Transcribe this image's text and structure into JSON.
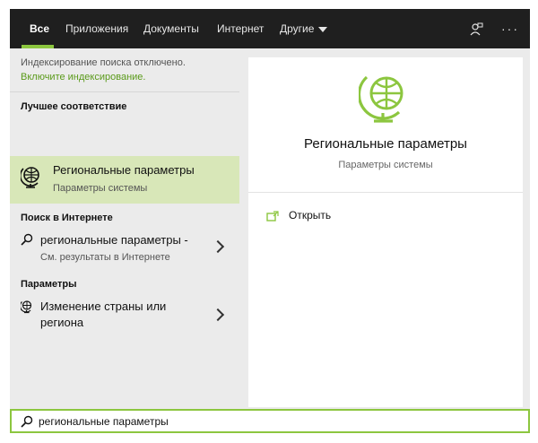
{
  "tabs": [
    {
      "label": "Все"
    },
    {
      "label": "Приложения"
    },
    {
      "label": "Документы"
    },
    {
      "label": "Интернет"
    },
    {
      "label": "Другие"
    }
  ],
  "notice": {
    "text": "Индексирование поиска отключено.",
    "link": "Включите индексирование."
  },
  "best_match": {
    "heading": "Лучшее соответствие",
    "title": "Региональные параметры",
    "subtitle": "Параметры системы"
  },
  "web_search": {
    "heading": "Поиск в Интернете",
    "title": "региональные параметры -",
    "subtitle": "См. результаты в Интернете"
  },
  "settings": {
    "heading": "Параметры",
    "title_line1": "Изменение страны или",
    "title_line2": "региона"
  },
  "preview": {
    "title": "Региональные параметры",
    "subtitle": "Параметры системы",
    "action": "Открыть"
  },
  "search": {
    "query": "региональные параметры"
  },
  "colors": {
    "accent": "#8cc63f",
    "topbar": "#1f1f1f",
    "highlight": "#d8e7b8"
  }
}
